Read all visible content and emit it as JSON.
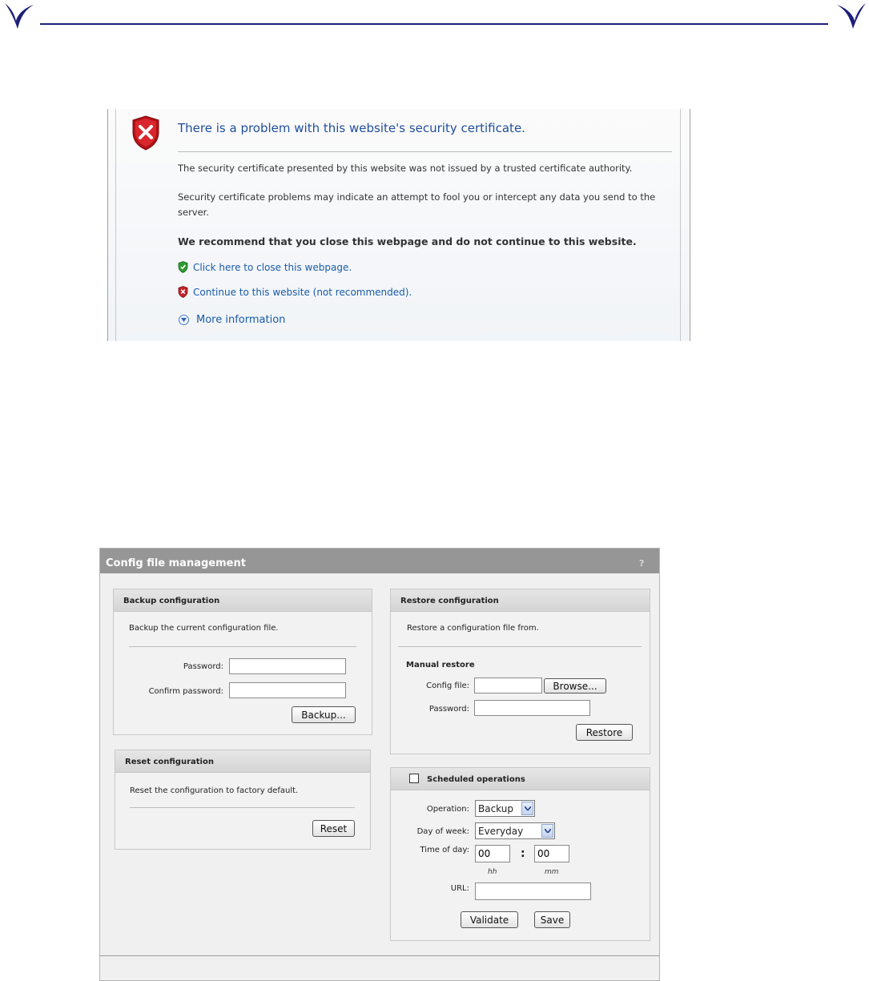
{
  "cert_error": {
    "title": "There is a problem with this website's security certificate.",
    "paragraph_1": "The security certificate presented by this website was not issued by a trusted certificate authority.",
    "paragraph_2": "Security certificate problems may indicate an attempt to fool you or intercept any data you send to the server.",
    "recommendation": "We recommend that you close this webpage and do not continue to this website.",
    "close_link": "Click here to close this webpage.",
    "continue_link": "Continue to this website (not recommended).",
    "more_info": "More information"
  },
  "config": {
    "title": "Config file management",
    "help": "?",
    "backup": {
      "title": "Backup configuration",
      "description": "Backup the current configuration file.",
      "password_label": "Password:",
      "password_value": "",
      "confirm_label": "Confirm password:",
      "confirm_value": "",
      "button": "Backup..."
    },
    "reset": {
      "title": "Reset configuration",
      "description": "Reset the configuration to factory default.",
      "button": "Reset"
    },
    "restore": {
      "title": "Restore configuration",
      "description": "Restore a configuration file from.",
      "manual_title": "Manual restore",
      "config_file_label": "Config file:",
      "config_file_value": "",
      "browse_button": "Browse...",
      "password_label": "Password:",
      "password_value": "",
      "button": "Restore"
    },
    "scheduled": {
      "title": "Scheduled operations",
      "checked": false,
      "operation_label": "Operation:",
      "operation_value": "Backup",
      "day_label": "Day of week:",
      "day_value": "Everyday",
      "time_label": "Time of day:",
      "hour_value": "00",
      "separator": ":",
      "minute_value": "00",
      "hh_hint": "hh",
      "mm_hint": "mm",
      "url_label": "URL:",
      "url_value": "",
      "validate_button": "Validate",
      "save_button": "Save"
    }
  },
  "colors": {
    "header_rule": "#1d1f7a",
    "link_blue": "#1a5ba8",
    "panel_header": "#969696"
  }
}
